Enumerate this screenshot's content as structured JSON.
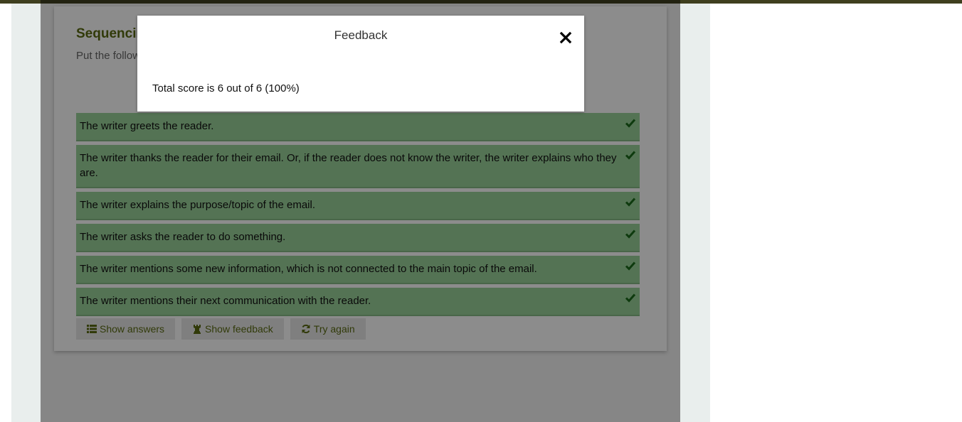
{
  "activity": {
    "title": "Sequencing",
    "instruction": "Put the following"
  },
  "items": [
    "The writer greets the reader.",
    "The writer thanks the reader for their email. Or, if the reader does not know the writer, the writer explains who they are.",
    "The writer explains the purpose/topic of the email.",
    "The writer asks the reader to do something.",
    "The writer mentions some new information, which is not connected to the main topic of the email.",
    "The writer mentions their next communication with the reader."
  ],
  "buttons": {
    "show_answers": "Show answers",
    "show_feedback": "Show feedback",
    "try_again": "Try again"
  },
  "modal": {
    "title": "Feedback",
    "body": "Total score is 6 out of 6 (100%)"
  },
  "colors": {
    "title_green": "#5a6b12",
    "correct_item_bg": "#9ad19a",
    "check_green": "#1a6b1a"
  }
}
